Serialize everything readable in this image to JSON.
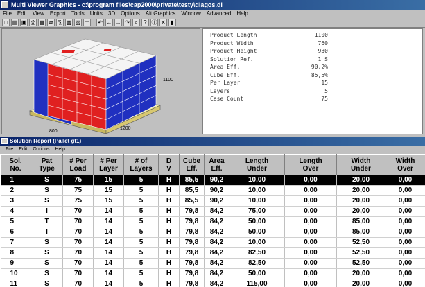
{
  "window": {
    "title": "Multi Viewer Graphics - c:\\program files\\cap2000\\private\\testy\\diagos.dl"
  },
  "menu": [
    "File",
    "Edit",
    "View",
    "Export",
    "Tools",
    "Units",
    "3D",
    "Options",
    "Alt Graphics",
    "Window",
    "Advanced",
    "Help"
  ],
  "toolbar_icons": [
    "new-icon",
    "open-icon",
    "save-icon",
    "print-icon",
    "preview-icon",
    "copy-icon",
    "paste-icon",
    "grid-icon",
    "image-icon",
    "pallet-icon",
    "undo-icon",
    "left-arrow-icon",
    "right-arrow-icon",
    "redo-icon",
    "zoom-icon",
    "help-icon",
    "info-icon",
    "close-icon",
    "book-icon"
  ],
  "view3d": {
    "dim_width": "1100",
    "dim_depth": "800",
    "dim_length": "1200"
  },
  "summary": {
    "rows": [
      {
        "label": "Product Length",
        "value": "1100"
      },
      {
        "label": "Product Width",
        "value": "760"
      },
      {
        "label": "Product Height",
        "value": "930"
      },
      {
        "label": "Solution Ref.",
        "value": "1 S"
      },
      {
        "label": "Area Eff.",
        "value": "90,2%"
      },
      {
        "label": "Cube Eff.",
        "value": "85,5%"
      },
      {
        "label": "Per Layer",
        "value": "15"
      },
      {
        "label": "Layers",
        "value": "5"
      },
      {
        "label": "Case Count",
        "value": "75"
      }
    ]
  },
  "report": {
    "title": "Solution Report (Pallet gt1)",
    "menu": [
      "File",
      "Edit",
      "Options",
      "Help"
    ],
    "columns": [
      "Sol.\nNo.",
      "Pat\nType",
      "# Per\nLoad",
      "# Per\nLayer",
      "# of\nLayers",
      "D\nV",
      "Cube\nEff.",
      "Area\nEff.",
      "Length\nUnder",
      "Length\nOver",
      "Width\nUnder",
      "Width\nOver"
    ],
    "rows": [
      [
        "1",
        "S",
        "75",
        "15",
        "5",
        "H",
        "85,5",
        "90,2",
        "10,00",
        "0,00",
        "20,00",
        "0,00"
      ],
      [
        "2",
        "S",
        "75",
        "15",
        "5",
        "H",
        "85,5",
        "90,2",
        "10,00",
        "0,00",
        "20,00",
        "0,00"
      ],
      [
        "3",
        "S",
        "75",
        "15",
        "5",
        "H",
        "85,5",
        "90,2",
        "10,00",
        "0,00",
        "20,00",
        "0,00"
      ],
      [
        "4",
        "I",
        "70",
        "14",
        "5",
        "H",
        "79,8",
        "84,2",
        "75,00",
        "0,00",
        "20,00",
        "0,00"
      ],
      [
        "5",
        "T",
        "70",
        "14",
        "5",
        "H",
        "79,8",
        "84,2",
        "50,00",
        "0,00",
        "85,00",
        "0,00"
      ],
      [
        "6",
        "I",
        "70",
        "14",
        "5",
        "H",
        "79,8",
        "84,2",
        "50,00",
        "0,00",
        "85,00",
        "0,00"
      ],
      [
        "7",
        "S",
        "70",
        "14",
        "5",
        "H",
        "79,8",
        "84,2",
        "10,00",
        "0,00",
        "52,50",
        "0,00"
      ],
      [
        "8",
        "S",
        "70",
        "14",
        "5",
        "H",
        "79,8",
        "84,2",
        "82,50",
        "0,00",
        "52,50",
        "0,00"
      ],
      [
        "9",
        "S",
        "70",
        "14",
        "5",
        "H",
        "79,8",
        "84,2",
        "82,50",
        "0,00",
        "52,50",
        "0,00"
      ],
      [
        "10",
        "S",
        "70",
        "14",
        "5",
        "H",
        "79,8",
        "84,2",
        "50,00",
        "0,00",
        "20,00",
        "0,00"
      ],
      [
        "11",
        "S",
        "70",
        "14",
        "5",
        "H",
        "79,8",
        "84,2",
        "115,00",
        "0,00",
        "20,00",
        "0,00"
      ]
    ],
    "selected_row": 0
  },
  "colors": {
    "title_bar": "#0a246a",
    "box_red": "#e02020",
    "box_blue": "#2030c0",
    "box_white": "#f4f4f4",
    "pallet": "#f0e8a0"
  }
}
